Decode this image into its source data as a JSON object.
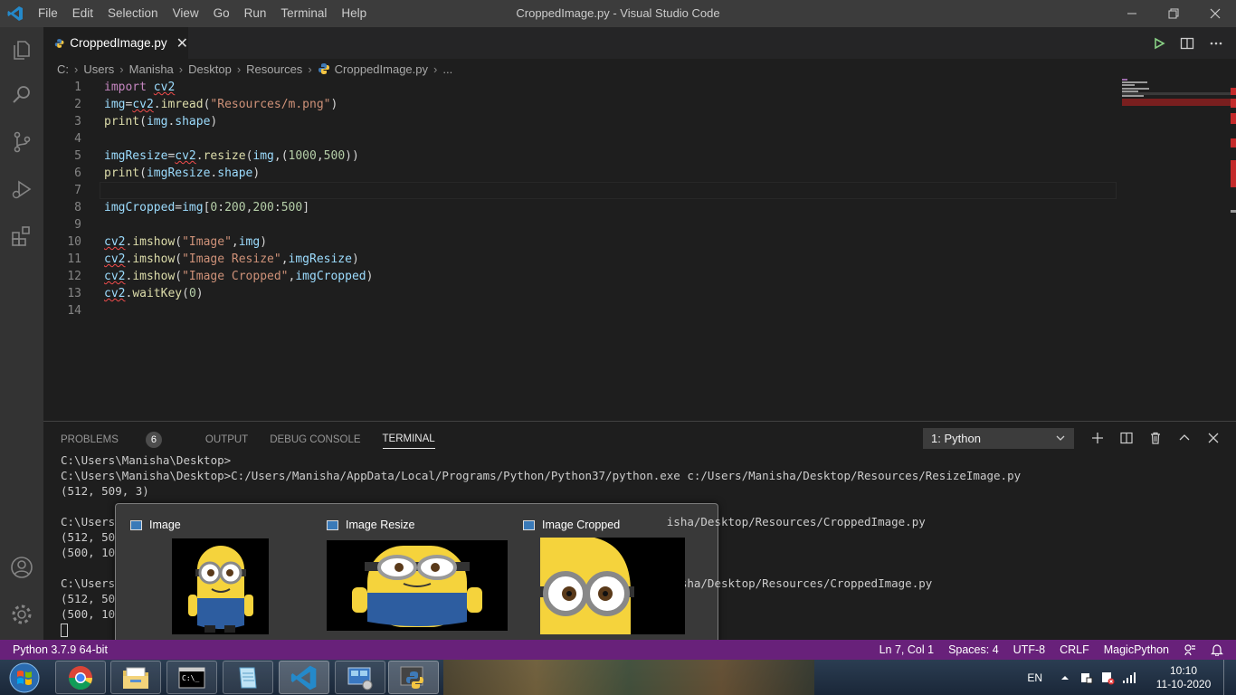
{
  "titlebar": {
    "title": "CroppedImage.py - Visual Studio Code",
    "menu": [
      "File",
      "Edit",
      "Selection",
      "View",
      "Go",
      "Run",
      "Terminal",
      "Help"
    ]
  },
  "activity_bar": [
    "files-icon",
    "search-icon",
    "source-control-icon",
    "run-debug-icon",
    "extensions-icon",
    "account-icon",
    "settings-gear-icon"
  ],
  "tab": {
    "label": "CroppedImage.py",
    "close": "✕"
  },
  "breadcrumb": [
    "C:",
    "Users",
    "Manisha",
    "Desktop",
    "Resources",
    "CroppedImage.py",
    "..."
  ],
  "code_lines": [
    {
      "n": "1",
      "text": "import cv2"
    },
    {
      "n": "2",
      "text": "img=cv2.imread(\"Resources/m.png\")"
    },
    {
      "n": "3",
      "text": "print(img.shape)"
    },
    {
      "n": "4",
      "text": ""
    },
    {
      "n": "5",
      "text": "imgResize=cv2.resize(img,(1000,500))"
    },
    {
      "n": "6",
      "text": "print(imgResize.shape)"
    },
    {
      "n": "7",
      "text": ""
    },
    {
      "n": "8",
      "text": "imgCropped=img[0:200,200:500]"
    },
    {
      "n": "9",
      "text": ""
    },
    {
      "n": "10",
      "text": "cv2.imshow(\"Image\",img)"
    },
    {
      "n": "11",
      "text": "cv2.imshow(\"Image Resize\",imgResize)"
    },
    {
      "n": "12",
      "text": "cv2.imshow(\"Image Cropped\",imgCropped)"
    },
    {
      "n": "13",
      "text": "cv2.waitKey(0)"
    },
    {
      "n": "14",
      "text": ""
    }
  ],
  "panel": {
    "tabs": [
      "PROBLEMS",
      "OUTPUT",
      "DEBUG CONSOLE",
      "TERMINAL"
    ],
    "problems_count": "6",
    "terminal_select": "1: Python",
    "terminal_lines": [
      "C:\\Users\\Manisha\\Desktop>",
      "C:\\Users\\Manisha\\Desktop>C:/Users/Manisha/AppData/Local/Programs/Python/Python37/python.exe c:/Users/Manisha/Desktop/Resources/ResizeImage.py",
      "(512, 509, 3)",
      "",
      "C:\\Users                                                                                 isha/Desktop/Resources/CroppedImage.py",
      "(512, 50",
      "(500, 10",
      "",
      "C:\\Users                                                                                 nisha/Desktop/Resources/CroppedImage.py",
      "(512, 50",
      "(500, 10"
    ]
  },
  "statusbar": {
    "python": "Python 3.7.9 64-bit",
    "position": "Ln 7, Col 1",
    "spaces": "Spaces: 4",
    "encoding": "UTF-8",
    "eol": "CRLF",
    "language": "MagicPython"
  },
  "thumbnails": [
    {
      "title": "Image"
    },
    {
      "title": "Image Resize"
    },
    {
      "title": "Image Cropped"
    }
  ],
  "taskbar": {
    "lang": "EN",
    "time": "10:10",
    "date": "11-10-2020"
  },
  "colors": {
    "statusbar": "#68217a",
    "titlebar": "#3c3c3c",
    "editor": "#1e1e1e"
  }
}
